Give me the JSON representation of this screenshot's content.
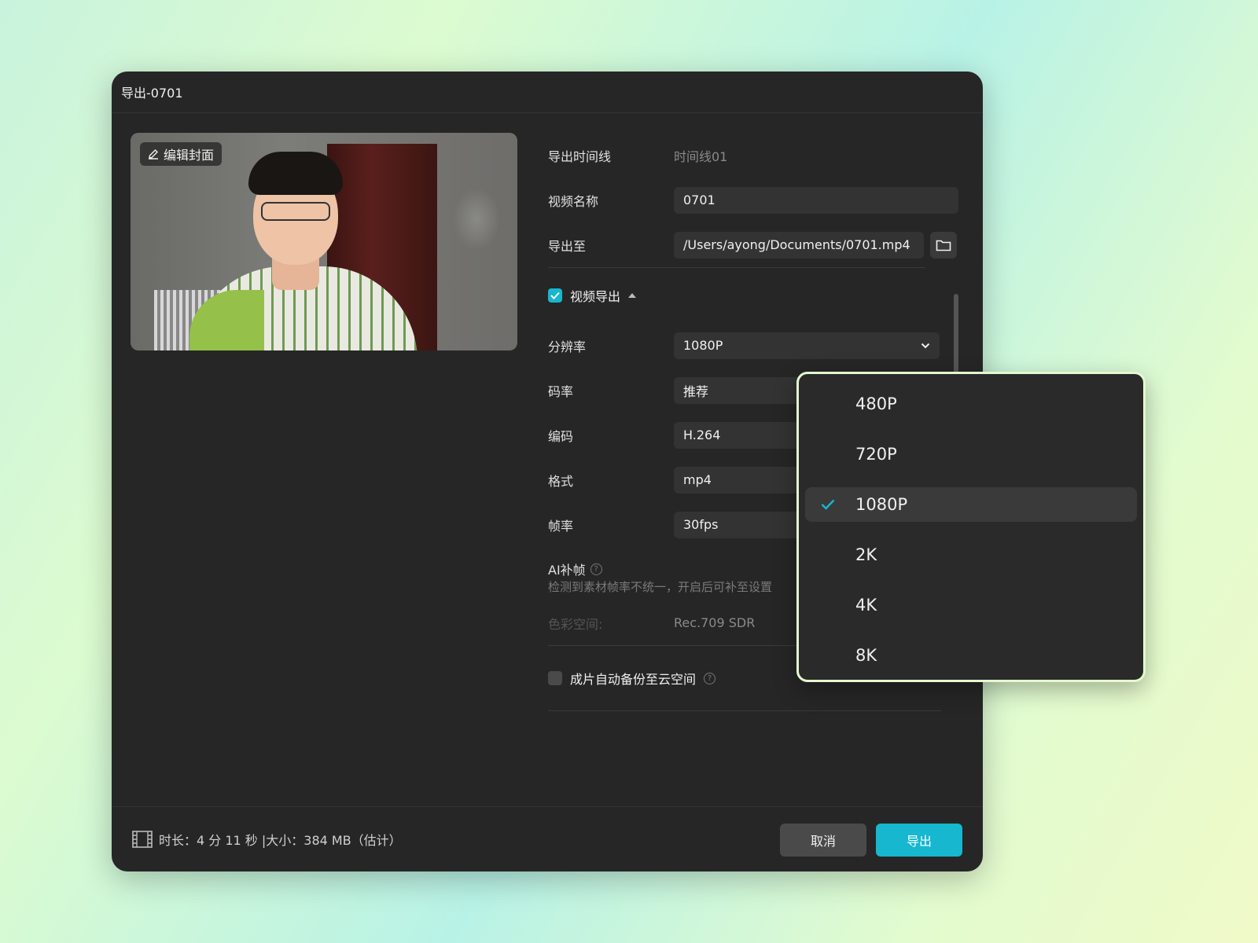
{
  "dialog": {
    "title": "导出-0701"
  },
  "preview": {
    "edit_cover_label": "编辑封面"
  },
  "form": {
    "timeline_label": "导出时间线",
    "timeline_value": "时间线01",
    "name_label": "视频名称",
    "name_value": "0701",
    "path_label": "导出至",
    "path_value": "/Users/ayong/Documents/0701.mp4",
    "video_export_label": "视频导出",
    "resolution_label": "分辨率",
    "resolution_value": "1080P",
    "bitrate_label": "码率",
    "bitrate_value": "推荐",
    "codec_label": "编码",
    "codec_value": "H.264",
    "format_label": "格式",
    "format_value": "mp4",
    "fps_label": "帧率",
    "fps_value": "30fps",
    "ai_frame_label": "AI补帧",
    "ai_frame_desc": "检测到素材帧率不统一，开启后可补至设置",
    "colorspace_label": "色彩空间:",
    "colorspace_value": "Rec.709 SDR",
    "backup_label": "成片自动备份至云空间"
  },
  "footer": {
    "info": "时长：4 分 11 秒 |大小：384 MB（估计）",
    "cancel_label": "取消",
    "export_label": "导出"
  },
  "dropdown": {
    "options": [
      "480P",
      "720P",
      "1080P",
      "2K",
      "4K",
      "8K"
    ],
    "selected": "1080P"
  },
  "colors": {
    "accent": "#16b7cf",
    "dropdown_border": "#e4f8ce"
  }
}
